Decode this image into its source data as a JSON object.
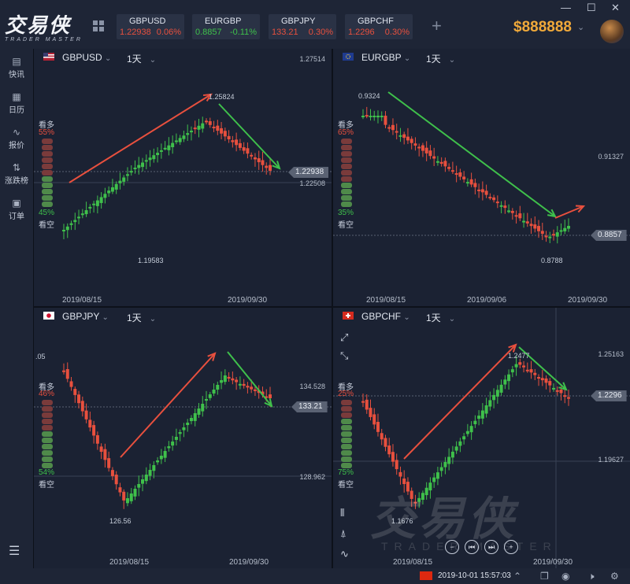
{
  "app": {
    "logo_cn": "交易侠",
    "logo_en": "TRADER MASTER",
    "balance": "$888888",
    "window": {
      "minimize": "—",
      "maximize": "☐",
      "close": "✕"
    }
  },
  "quotes": [
    {
      "symbol": "GBPUSD",
      "price": "1.22938",
      "change": "0.06%",
      "dir": "up"
    },
    {
      "symbol": "EURGBP",
      "price": "0.8857",
      "change": "-0.11%",
      "dir": "down"
    },
    {
      "symbol": "GBPJPY",
      "price": "133.21",
      "change": "0.30%",
      "dir": "up"
    },
    {
      "symbol": "GBPCHF",
      "price": "1.2296",
      "change": "0.30%",
      "dir": "up"
    }
  ],
  "sidebar": {
    "items": [
      {
        "label": "快讯",
        "icon": "news-icon"
      },
      {
        "label": "日历",
        "icon": "calendar-icon"
      },
      {
        "label": "报价",
        "icon": "chart-line-icon"
      },
      {
        "label": "涨跌榜",
        "icon": "sort-icon"
      },
      {
        "label": "订单",
        "icon": "order-icon"
      }
    ]
  },
  "panels": [
    {
      "symbol": "GBPUSD",
      "timeframe": "1天",
      "flag": "uk-us",
      "bull_label": "看多",
      "bull_pct": "55%",
      "bear_label": "看空",
      "bear_pct": "45%",
      "high_label": "1.25824",
      "low_label": "1.19583",
      "axis": [
        "1.27514",
        "1.22508"
      ],
      "current_price": "1.22938",
      "dates": [
        "2019/08/15",
        "2019/09/30"
      ]
    },
    {
      "symbol": "EURGBP",
      "timeframe": "1天",
      "flag": "eu-uk",
      "bull_label": "看多",
      "bull_pct": "65%",
      "bear_label": "看空",
      "bear_pct": "35%",
      "high_label": "0.9324",
      "low_label": "0.8788",
      "axis": [
        "0.91327"
      ],
      "current_price": "0.8857",
      "dates": [
        "2019/08/15",
        "2019/09/06",
        "2019/09/30"
      ]
    },
    {
      "symbol": "GBPJPY",
      "timeframe": "1天",
      "flag": "uk-jp",
      "bull_label": "看多",
      "bull_pct": "46%",
      "bear_label": "看空",
      "bear_pct": "54%",
      "high_label": ".05",
      "low_label": "126.56",
      "axis": [
        "134.528",
        "128.962"
      ],
      "current_price": "133.21",
      "dates": [
        "2019/08/15",
        "2019/09/30"
      ]
    },
    {
      "symbol": "GBPCHF",
      "timeframe": "1天",
      "flag": "uk-ch",
      "bull_label": "看多",
      "bull_pct": "25%",
      "bear_label": "看空",
      "bear_pct": "75%",
      "high_label": "1.2477",
      "low_label": "1.1676",
      "axis": [
        "1.25163",
        "1.19627"
      ],
      "current_price": "1.2296",
      "dates": [
        "2019/08/15",
        "2019/09/30"
      ]
    }
  ],
  "statusbar": {
    "time": "2019-10-01 15:57:03"
  }
}
